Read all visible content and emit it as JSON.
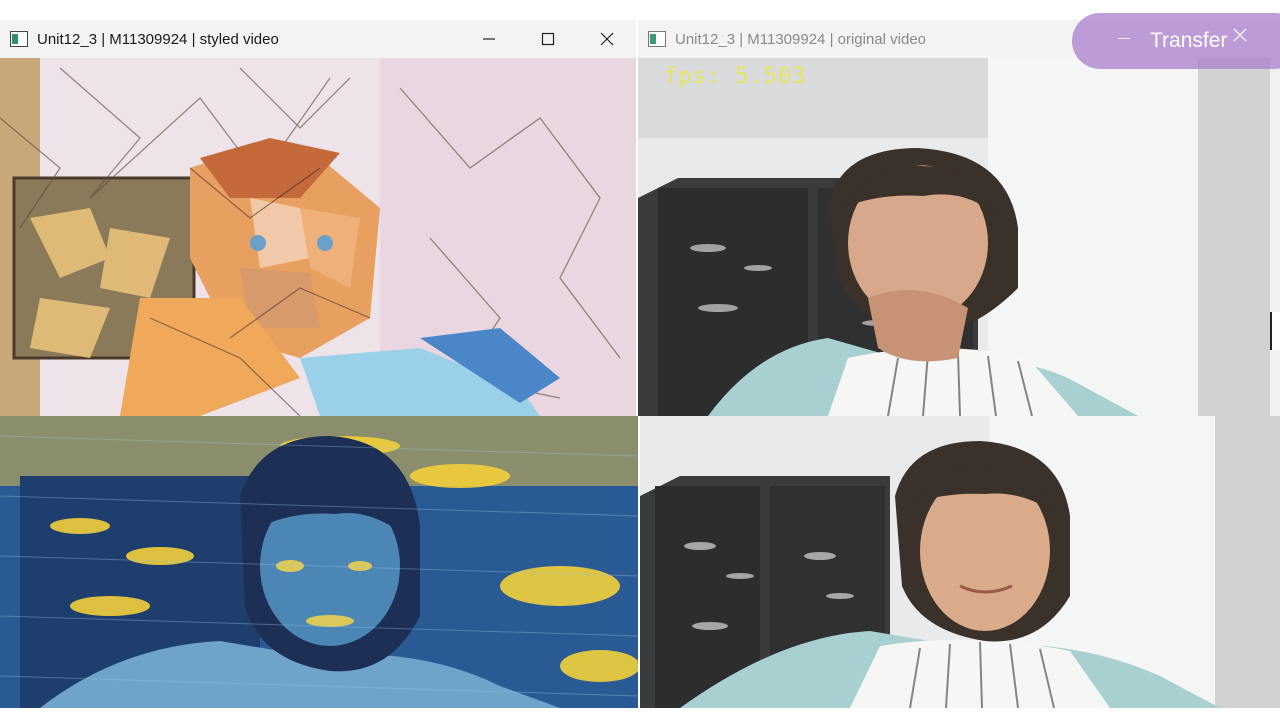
{
  "windows": {
    "styled": {
      "title": "Unit12_3 | M11309924 | styled video"
    },
    "original": {
      "title": "Unit12_3 | M11309924 | original video",
      "fps_label": "fps: 5.503"
    }
  },
  "transfer_button": {
    "label": "Transfer"
  },
  "icons": [
    "app-icon",
    "minimize-icon",
    "maximize-icon",
    "close-icon"
  ],
  "colors": {
    "titlebar": "#f3f3f3",
    "fps_text": "#e8e84a",
    "transfer_bg": "#ac82cd",
    "candy_wall": "#efe3ea",
    "vangogh_blue": "#2a5a94",
    "vangogh_yellow": "#f2cf3a",
    "room_wall": "#e9eaeb",
    "door_dark": "#3a3b3d"
  }
}
